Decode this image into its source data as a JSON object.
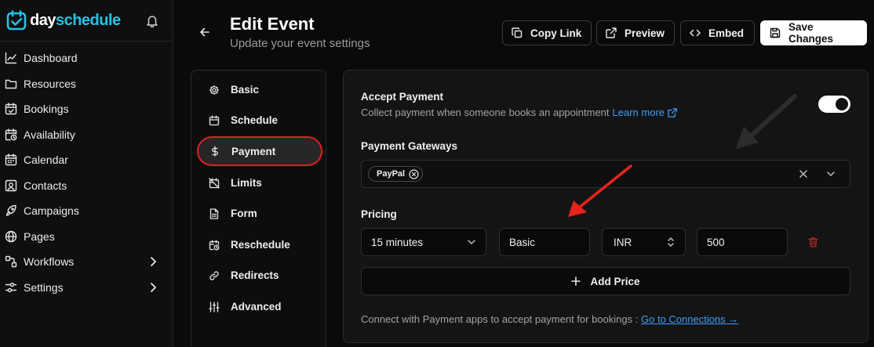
{
  "brand": {
    "name_part1": "day",
    "name_part2": "schedule"
  },
  "sidebar": {
    "items": [
      {
        "label": "Dashboard",
        "icon": "chart-line-icon"
      },
      {
        "label": "Resources",
        "icon": "folder-icon"
      },
      {
        "label": "Bookings",
        "icon": "calendar-check-icon"
      },
      {
        "label": "Availability",
        "icon": "calendar-clock-icon"
      },
      {
        "label": "Calendar",
        "icon": "calendar-icon"
      },
      {
        "label": "Contacts",
        "icon": "contact-icon"
      },
      {
        "label": "Campaigns",
        "icon": "rocket-icon"
      },
      {
        "label": "Pages",
        "icon": "globe-icon"
      },
      {
        "label": "Workflows",
        "icon": "workflow-icon",
        "has_submenu": true
      },
      {
        "label": "Settings",
        "icon": "sliders-icon",
        "has_submenu": true
      }
    ]
  },
  "header": {
    "title": "Edit Event",
    "subtitle": "Update your event settings",
    "copy_link": "Copy Link",
    "preview": "Preview",
    "embed": "Embed",
    "save": "Save Changes"
  },
  "subnav": {
    "items": [
      {
        "label": "Basic",
        "icon": "gear-icon"
      },
      {
        "label": "Schedule",
        "icon": "calendar-icon"
      },
      {
        "label": "Payment",
        "icon": "dollar-icon",
        "active": true
      },
      {
        "label": "Limits",
        "icon": "calendar-off-icon"
      },
      {
        "label": "Form",
        "icon": "file-text-icon"
      },
      {
        "label": "Reschedule",
        "icon": "calendar-clock-icon"
      },
      {
        "label": "Redirects",
        "icon": "link-icon"
      },
      {
        "label": "Advanced",
        "icon": "sliders-vertical-icon"
      }
    ]
  },
  "payment": {
    "accept_title": "Accept Payment",
    "accept_desc": "Collect payment when someone books an appointment",
    "learn_more": "Learn more",
    "accept_enabled": true,
    "gateways_label": "Payment Gateways",
    "gateways": [
      "PayPal"
    ],
    "pricing_label": "Pricing",
    "pricing_row": {
      "duration": "15 minutes",
      "name": "Basic",
      "currency": "INR",
      "amount": "500"
    },
    "add_price": "Add Price",
    "connect_text": "Connect with Payment apps to accept payment for bookings :",
    "connect_link": "Go to Connections →"
  },
  "colors": {
    "accent": "#22c3e6",
    "link": "#3b9eff",
    "highlight_red": "#e02020",
    "trash_red": "#b42323",
    "background": "#0a0a0a"
  }
}
